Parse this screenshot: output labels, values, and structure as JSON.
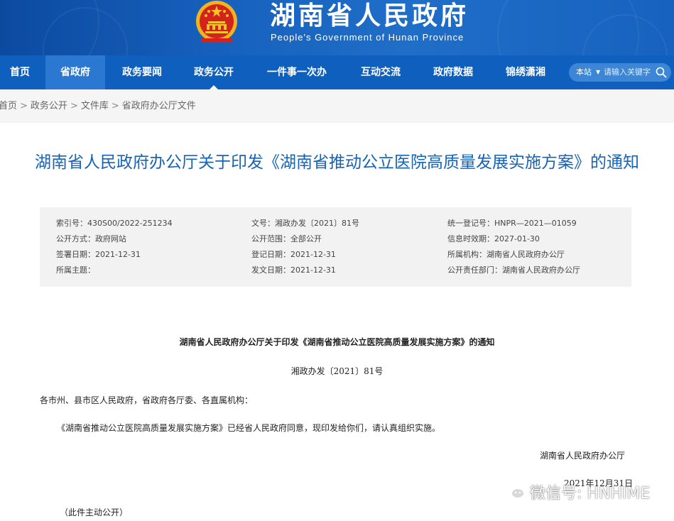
{
  "header": {
    "title": "湖南省人民政府",
    "subtitle": "People's Government of Hunan Province"
  },
  "nav": {
    "items": [
      "首页",
      "省政府",
      "政务要闻",
      "政务公开",
      "一件事一次办",
      "互动交流",
      "政府数据",
      "锦绣潇湘"
    ],
    "search_scope": "本站",
    "search_placeholder": "请输入关键字"
  },
  "breadcrumb": [
    "首页",
    "政务公开",
    "文件库",
    "省政府办公厅文件"
  ],
  "document": {
    "title": "湖南省人民政府办公厅关于印发《湖南省推动公立医院高质量发展实施方案》的通知",
    "meta": {
      "index_no": "索引号：430S00/2022-251234",
      "doc_no": "文号：湘政办发〔2021〕81号",
      "unified_no": "统一登记号：HNPR—2021—01059",
      "publish_mode": "公开方式：政府网站",
      "publish_scope": "公开范围：全部公开",
      "valid_until": "信息时效期：2027-01-30",
      "sign_date": "签署日期：2021-12-31",
      "register_date": "登记日期：2021-12-31",
      "org": "所属机构：湖南省人民政府办公厅",
      "topic": "所属主题：",
      "issue_date": "发文日期：2021-12-31",
      "resp_dept": "公开责任部门：湖南省人民政府办公厅"
    }
  },
  "article": {
    "title": "湖南省人民政府办公厅关于印发《湖南省推动公立医院高质量发展实施方案》的通知",
    "number": "湘政办发〔2021〕81号",
    "salutation": "各市州、县市区人民政府，省政府各厅委、各直属机构：",
    "body": "《湖南省推动公立医院高质量发展实施方案》已经省人民政府同意，现印发给你们，请认真组织实施。",
    "signature": "湖南省人民政府办公厅",
    "date": "2021年12月31日",
    "note": "（此件主动公开）"
  },
  "watermark": {
    "text": "微信号: HNHIME"
  },
  "colors": {
    "header_blue": "#1762be",
    "nav_blue": "#0f5fbf",
    "title_blue": "#1763b5"
  }
}
